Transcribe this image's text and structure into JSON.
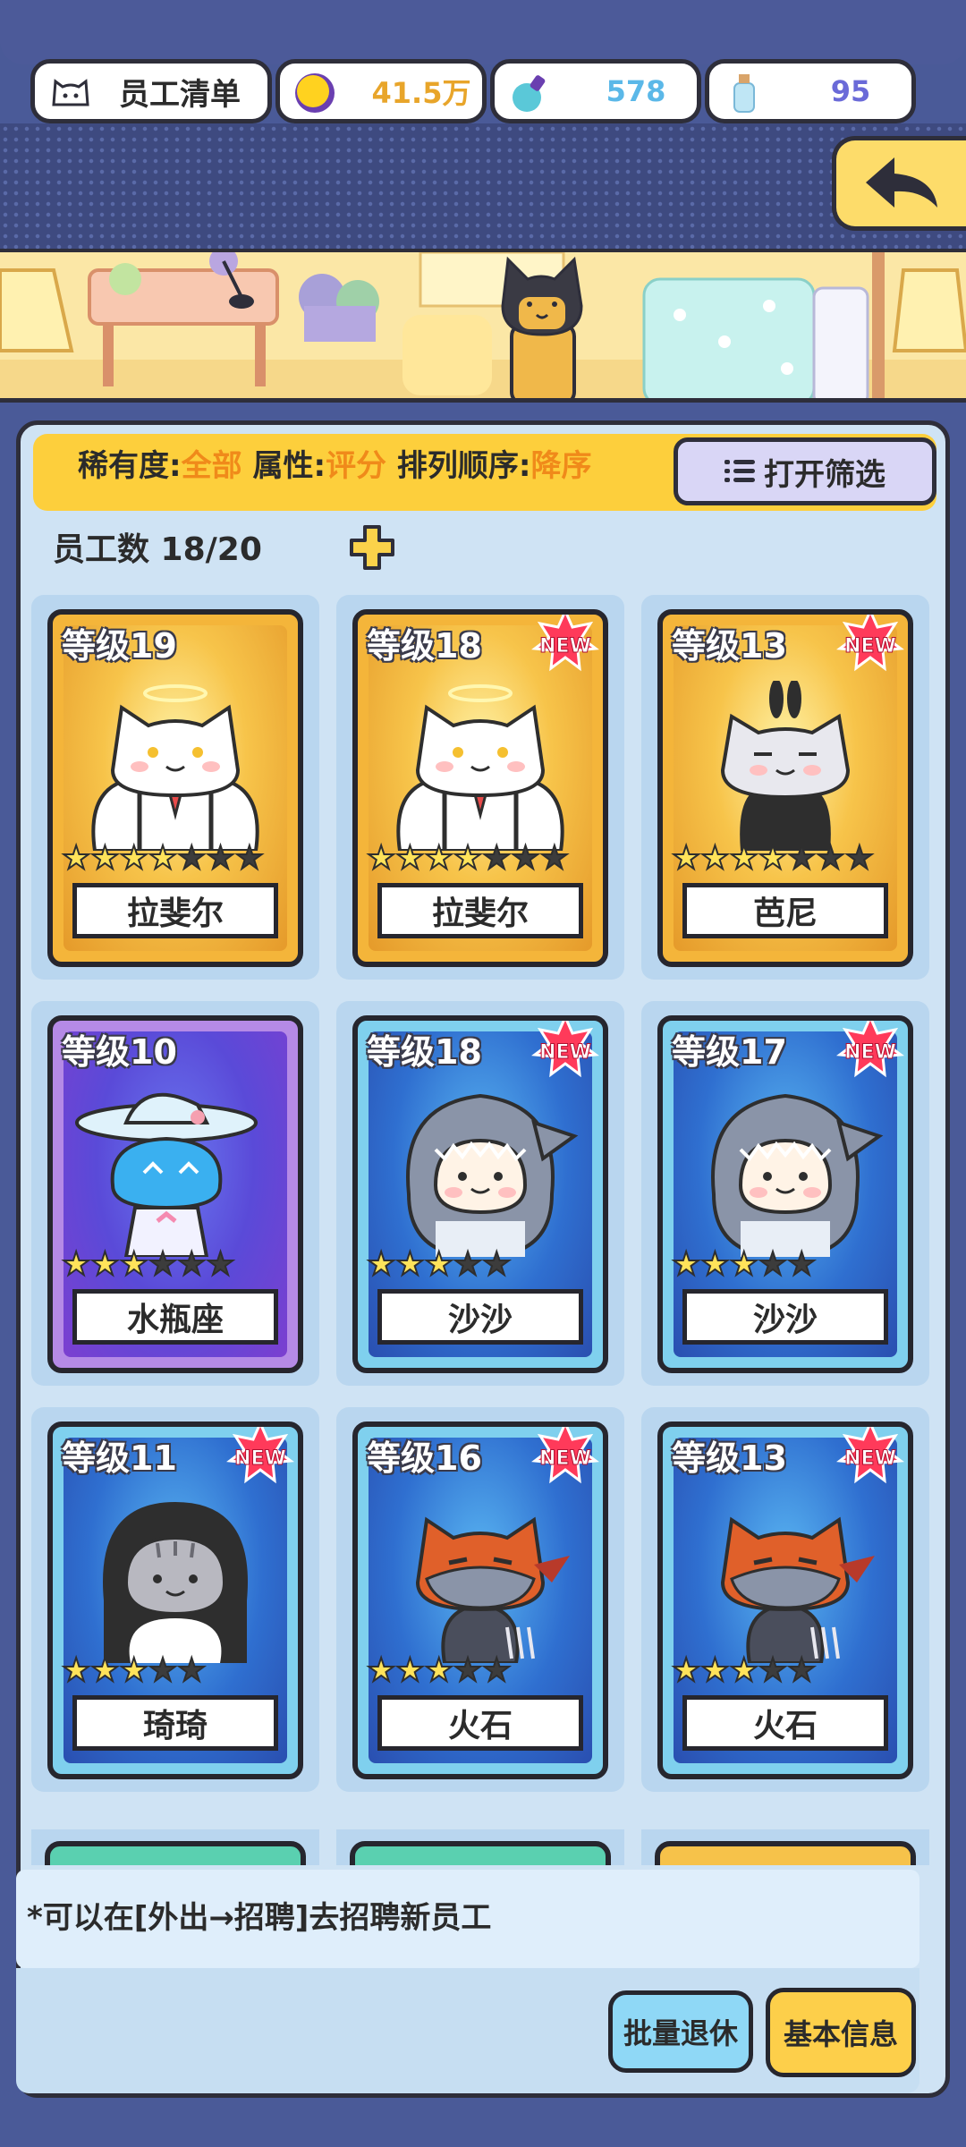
{
  "hud": {
    "staff_list_label": "员工清单",
    "coins": "41.5万",
    "potions": "578",
    "bottles": "95",
    "coin_color": "#e8a52a",
    "potion_color": "#5bb8e8",
    "bottle_color": "#6a6ad8"
  },
  "filter": {
    "rarity_label": "稀有度:",
    "rarity_value": "全部",
    "attribute_label": "属性:",
    "attribute_value": "评分",
    "order_label": "排列顺序:",
    "order_value": "降序",
    "open_filter_label": "打开筛选"
  },
  "staff_count_label": "员工数 18/20",
  "cards": [
    {
      "level": "等级19",
      "name": "拉斐尔",
      "rarity": "gold",
      "stars": 4,
      "total_stars": 7,
      "is_new": false,
      "cat": "angel-white"
    },
    {
      "level": "等级18",
      "name": "拉斐尔",
      "rarity": "gold",
      "stars": 4,
      "total_stars": 7,
      "is_new": true,
      "cat": "angel-white"
    },
    {
      "level": "等级13",
      "name": "芭尼",
      "rarity": "gold",
      "stars": 4,
      "total_stars": 7,
      "is_new": true,
      "cat": "bunny-grey"
    },
    {
      "level": "等级10",
      "name": "水瓶座",
      "rarity": "purple",
      "stars": 3,
      "total_stars": 6,
      "is_new": false,
      "cat": "aquarius-blue"
    },
    {
      "level": "等级18",
      "name": "沙沙",
      "rarity": "blue",
      "stars": 3,
      "total_stars": 5,
      "is_new": true,
      "cat": "shark"
    },
    {
      "level": "等级17",
      "name": "沙沙",
      "rarity": "blue",
      "stars": 3,
      "total_stars": 5,
      "is_new": true,
      "cat": "shark"
    },
    {
      "level": "等级11",
      "name": "琦琦",
      "rarity": "blue",
      "stars": 3,
      "total_stars": 5,
      "is_new": true,
      "cat": "penguin-tabby"
    },
    {
      "level": "等级16",
      "name": "火石",
      "rarity": "blue",
      "stars": 3,
      "total_stars": 5,
      "is_new": true,
      "cat": "ninja-orange"
    },
    {
      "level": "等级13",
      "name": "火石",
      "rarity": "blue",
      "stars": 3,
      "total_stars": 5,
      "is_new": true,
      "cat": "ninja-orange"
    }
  ],
  "new_badge_text": "NEW",
  "hint": "*可以在[外出→招聘]去招聘新员工",
  "buttons": {
    "batch_retire": "批量退休",
    "basic_info": "基本信息"
  }
}
